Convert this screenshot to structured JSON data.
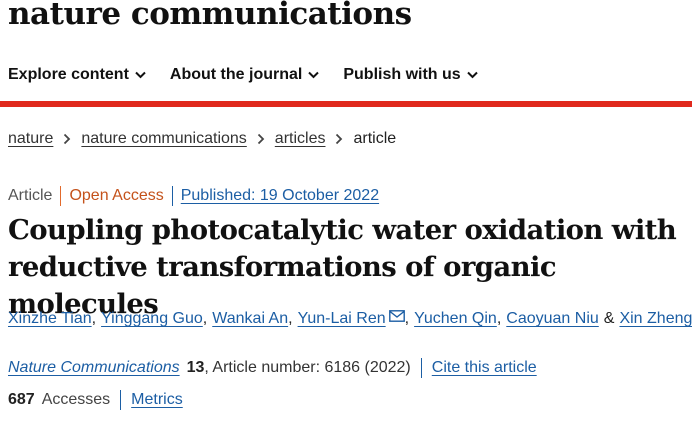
{
  "site": {
    "brand": "nature communications"
  },
  "nav": [
    {
      "label": "Explore content"
    },
    {
      "label": "About the journal"
    },
    {
      "label": "Publish with us"
    }
  ],
  "breadcrumb": {
    "items": [
      "nature",
      "nature communications",
      "articles"
    ],
    "current": "article"
  },
  "article": {
    "type": "Article",
    "access": "Open Access",
    "published": "Published: 19 October 2022",
    "title_line1": "Coupling photocatalytic water oxidation with",
    "title_line2": "reductive transformations of organic molecules",
    "authors": [
      "Xinzhe Tian",
      "Yinggang Guo",
      "Wankai An",
      "Yun-Lai Ren",
      "Yuchen Qin",
      "Caoyuan Niu",
      "Xin Zheng"
    ],
    "and_symbol": "&",
    "citation": {
      "journal": "Nature Communications",
      "volume": "13",
      "article_number": ", Article number: 6186 (2022)",
      "cite_link": "Cite this article"
    },
    "metrics": {
      "accesses": "687",
      "accesses_label": "Accesses",
      "metrics_link": "Metrics"
    }
  },
  "colors": {
    "accent_red": "#e0291d",
    "link_blue": "#1c5ea4",
    "open_access_orange": "#c4521b"
  },
  "icons": {
    "nav_chevron": "chevron-down-icon",
    "breadcrumb_separator": "chevron-right-icon",
    "corresponding_author": "mail-icon"
  }
}
